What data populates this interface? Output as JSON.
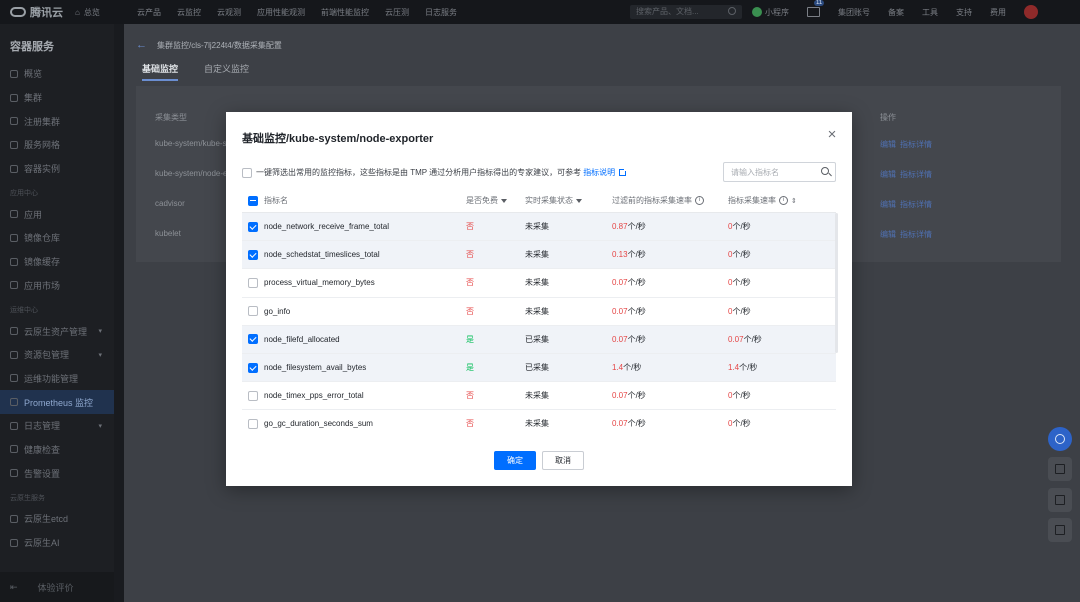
{
  "topbar": {
    "brand": "腾讯云",
    "home": "总览",
    "nav": [
      "云产品",
      "云监控",
      "云观测",
      "应用性能观测",
      "前端性能监控",
      "云压测",
      "日志服务"
    ],
    "search_placeholder": "搜索产品、文档...",
    "miniapp": "小程序",
    "mail_badge": "11",
    "right_items": [
      "集团账号",
      "备案",
      "工具",
      "支持",
      "费用"
    ]
  },
  "sidebar": {
    "title": "容器服务",
    "groups": [
      {
        "label": "",
        "items": [
          "概览",
          "集群",
          "注册集群",
          "服务网格",
          "容器实例"
        ]
      },
      {
        "label": "应用中心",
        "items": [
          "应用",
          "镜像仓库",
          "镜像缓存",
          "应用市场"
        ]
      },
      {
        "label": "运维中心",
        "items": [
          "云原生资产管理",
          "资源包管理",
          "运维功能管理",
          "Prometheus 监控",
          "日志管理",
          "健康检查",
          "告警设置"
        ]
      },
      {
        "label": "云原生服务",
        "items": [
          "云原生etcd",
          "云原生AI"
        ]
      }
    ],
    "active_item": "Prometheus 监控",
    "footer": "体验评价"
  },
  "page": {
    "breadcrumb": "集群监控/cls-7lj224t4/数据采集配置",
    "tabs": [
      "基础监控",
      "自定义监控"
    ],
    "bg_table_header": [
      "采集类型",
      "操作"
    ],
    "bg_rows": [
      "kube-system/kube-st",
      "kube-system/node-e",
      "cadvisor",
      "kubelet"
    ],
    "bg_actions": [
      "编辑",
      "指标详情"
    ]
  },
  "modal": {
    "title": "基础监控/kube-system/node-exporter",
    "close_label": "×",
    "filter_text": "一键筛选出常用的监控指标，这些指标是由 TMP 通过分析用户指标得出的专家建议，可参考",
    "filter_link": "指标说明",
    "search_placeholder": "请输入指标名",
    "columns": {
      "name": "指标名",
      "free": "是否免费",
      "status": "实时采集状态",
      "rate_before": "过滤前的指标采集速率",
      "rate": "指标采集速率"
    },
    "rows": [
      {
        "checked": true,
        "name": "node_network_receive_frame_total",
        "free": "否",
        "status": "未采集",
        "rate_before": "0.87个/秒",
        "rate": "0个/秒"
      },
      {
        "checked": true,
        "name": "node_schedstat_timeslices_total",
        "free": "否",
        "status": "未采集",
        "rate_before": "0.13个/秒",
        "rate": "0个/秒"
      },
      {
        "checked": false,
        "name": "process_virtual_memory_bytes",
        "free": "否",
        "status": "未采集",
        "rate_before": "0.07个/秒",
        "rate": "0个/秒"
      },
      {
        "checked": false,
        "name": "go_info",
        "free": "否",
        "status": "未采集",
        "rate_before": "0.07个/秒",
        "rate": "0个/秒"
      },
      {
        "checked": true,
        "name": "node_filefd_allocated",
        "free": "是",
        "status": "已采集",
        "rate_before": "0.07个/秒",
        "rate": "0.07个/秒"
      },
      {
        "checked": true,
        "name": "node_filesystem_avail_bytes",
        "free": "是",
        "status": "已采集",
        "rate_before": "1.4个/秒",
        "rate": "1.4个/秒"
      },
      {
        "checked": false,
        "name": "node_timex_pps_error_total",
        "free": "否",
        "status": "未采集",
        "rate_before": "0.07个/秒",
        "rate": "0个/秒"
      },
      {
        "checked": false,
        "name": "go_gc_duration_seconds_sum",
        "free": "否",
        "status": "未采集",
        "rate_before": "0.07个/秒",
        "rate": "0个/秒"
      }
    ],
    "confirm_label": "确定",
    "cancel_label": "取消"
  },
  "colors": {
    "primary": "#006eff",
    "danger": "#e54545",
    "success": "#0abf5b"
  }
}
